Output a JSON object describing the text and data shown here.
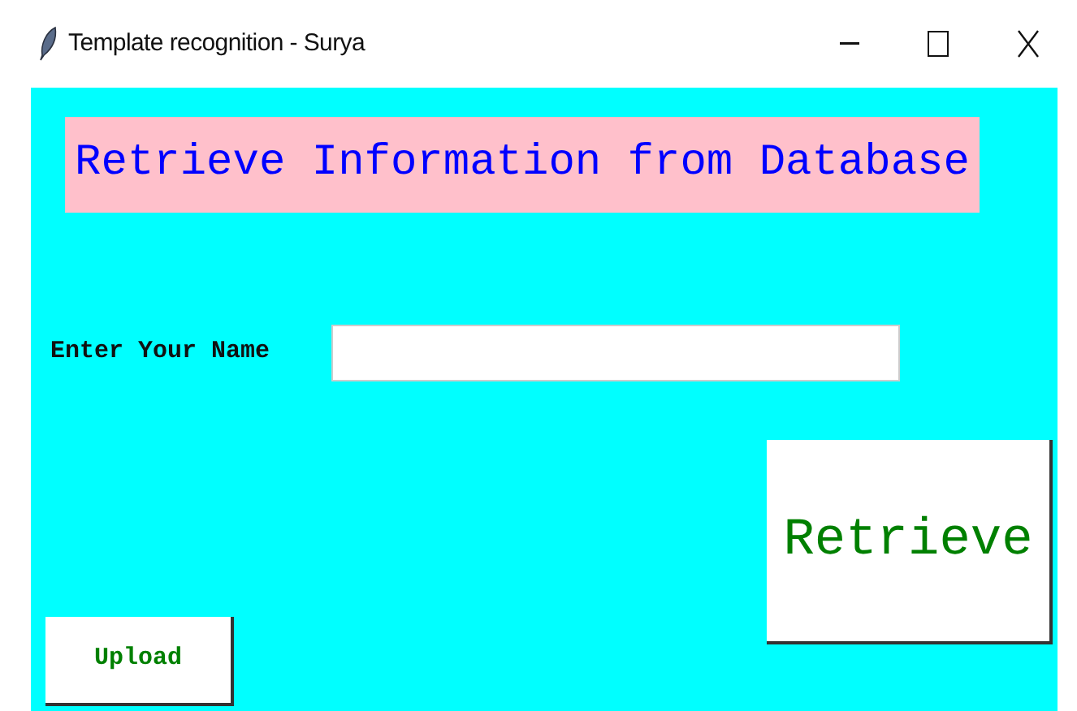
{
  "window": {
    "title": "Template recognition - Surya"
  },
  "heading": "Retrieve Information from Database",
  "name_field": {
    "label": "Enter Your Name"
  },
  "buttons": [
    {
      "label": "Retrieve"
    },
    {
      "label": "Upload"
    }
  ]
}
